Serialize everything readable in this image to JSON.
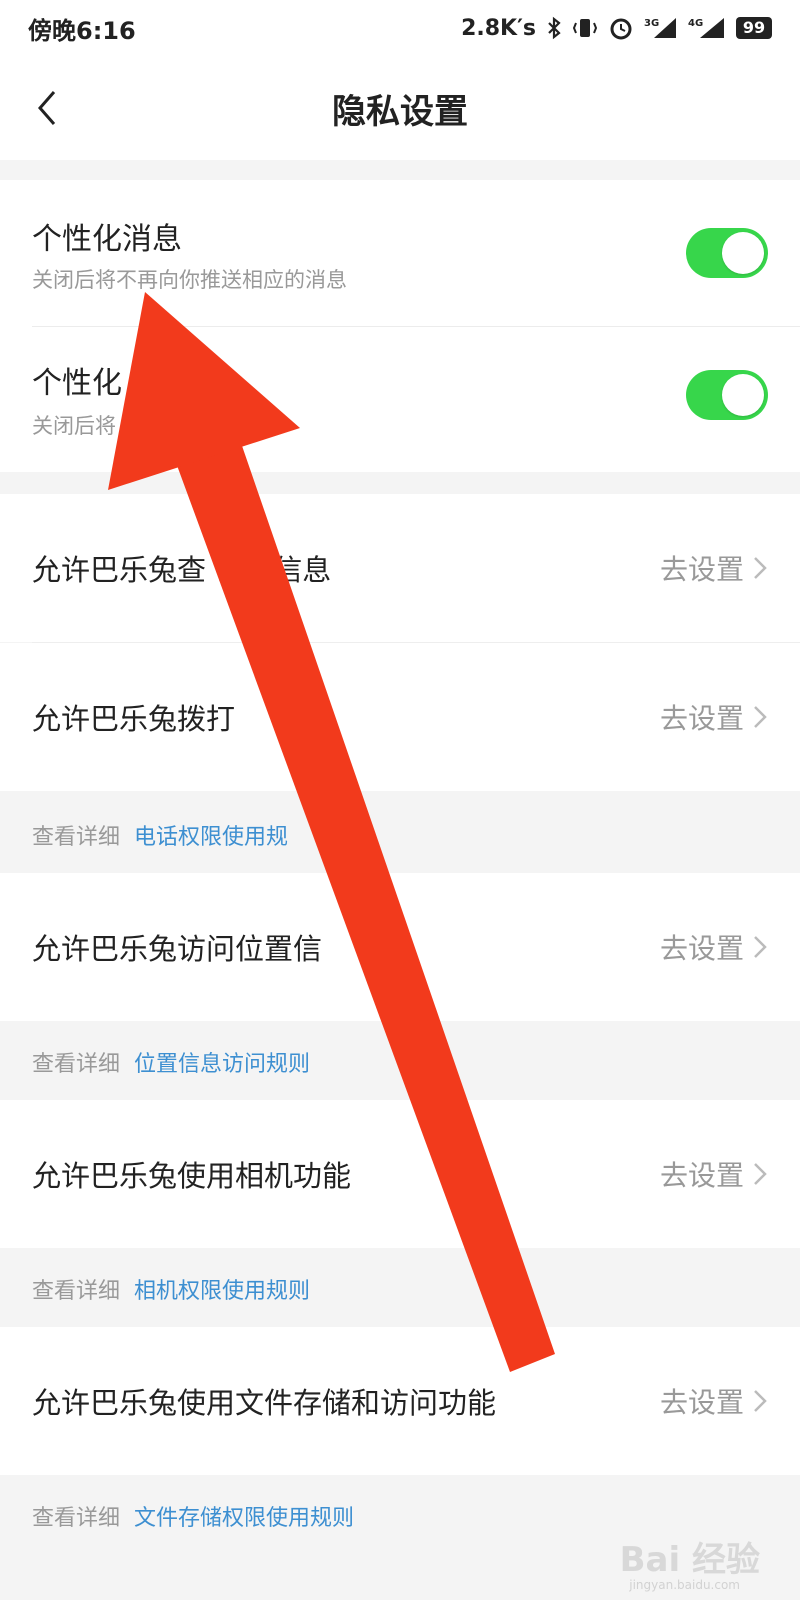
{
  "status_bar": {
    "time": "傍晚6:16",
    "net_speed": "2.8K′s",
    "signal_3g_label": "3G",
    "signal_4g_label": "4G",
    "battery": "99"
  },
  "header": {
    "title": "隐私设置"
  },
  "toggles": [
    {
      "title": "个性化消息",
      "subtitle": "关闭后将不再向你推送相应的消息",
      "on": true
    },
    {
      "title": "个性化",
      "subtitle": "关闭后将 性化推荐内容",
      "on": true
    }
  ],
  "permissions": [
    {
      "label": "允许巴乐兔查 设备信息",
      "action": "去设置"
    },
    {
      "label": "允许巴乐兔拨打",
      "action": "去设置"
    },
    {
      "label": "允许巴乐兔访问位置信",
      "action": "去设置"
    },
    {
      "label": "允许巴乐兔使用相机功能",
      "action": "去设置"
    },
    {
      "label": "允许巴乐兔使用文件存储和访问功能",
      "action": "去设置"
    }
  ],
  "details": [
    {
      "prefix": "查看详细",
      "link": "电话权限使用规"
    },
    {
      "prefix": "查看详细",
      "link": "位置信息访问规则"
    },
    {
      "prefix": "查看详细",
      "link": "相机权限使用规则"
    },
    {
      "prefix": "查看详细",
      "link": "文件存储权限使用规则"
    }
  ],
  "watermark": {
    "brand": "Bai 经验",
    "url": "jingyan.baidu.com"
  },
  "colors": {
    "toggle_on": "#37d64b",
    "link": "#3d8fd1",
    "arrow": "#f23a1c"
  }
}
